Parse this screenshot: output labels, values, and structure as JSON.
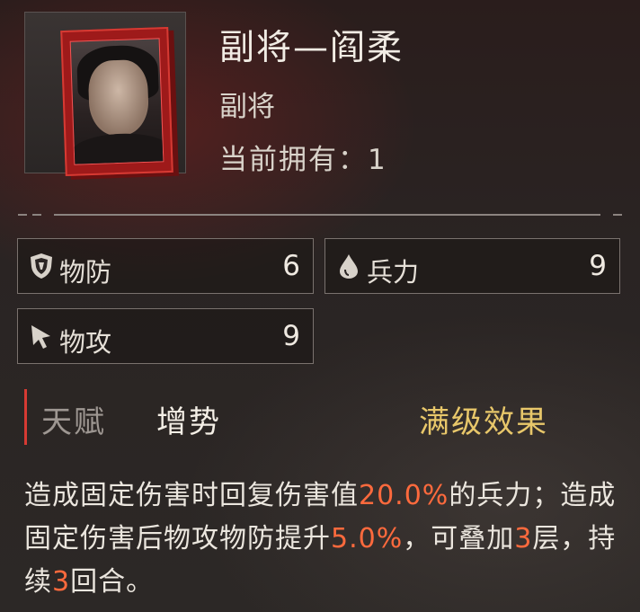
{
  "header": {
    "name": "副将—阎柔",
    "role": "副将",
    "owned_label": "当前拥有：",
    "owned_count": "1"
  },
  "portrait": {
    "icon": "general-portrait-card"
  },
  "stats": [
    {
      "label": "物防",
      "value": "6",
      "icon": "shield-icon"
    },
    {
      "label": "兵力",
      "value": "9",
      "icon": "drop-icon"
    },
    {
      "label": "物攻",
      "value": "9",
      "icon": "arrow-icon"
    }
  ],
  "talent": {
    "label": "天赋",
    "name": "增势",
    "full_effect": "满级效果"
  },
  "description": {
    "p1": "造成固定伤害时回复伤害值",
    "v1": "20.0%",
    "p2": "的兵力；造成固定伤害后物攻物防提升",
    "v2": "5.0%",
    "p3": "，可叠加",
    "v3": "3",
    "p4": "层，持续",
    "v4": "3",
    "p5": "回合。"
  },
  "colors": {
    "accent_red": "#d63a33",
    "highlight": "#ff6a3d",
    "gold": "#e8c76a"
  }
}
